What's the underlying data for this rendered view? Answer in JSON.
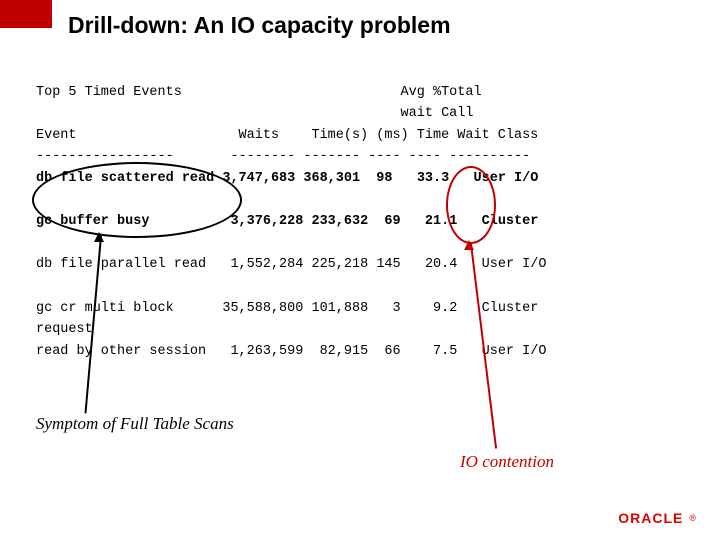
{
  "title": "Drill-down: An IO capacity problem",
  "report": {
    "heading_line1": "Top 5 Timed Events                           Avg %Total",
    "heading_line2": "                                             wait Call",
    "columns_line": "Event                    Waits    Time(s) (ms) Time Wait Class",
    "sep_line": "-----------------       -------- ------- ---- ---- ----------",
    "rows": [
      {
        "event": "db file scattered read",
        "waits": "3,747,683",
        "time_s": "368,301",
        "avg_ms": "98",
        "pct": "33.3",
        "class": "User I/O",
        "bold": true
      },
      {
        "event": "gc buffer busy",
        "waits": "3,376,228",
        "time_s": "233,632",
        "avg_ms": "69",
        "pct": "21.1",
        "class": "Cluster",
        "bold": true
      },
      {
        "event": "db file parallel read",
        "waits": "1,552,284",
        "time_s": "225,218",
        "avg_ms": "145",
        "pct": "20.4",
        "class": "User I/O",
        "bold": false
      },
      {
        "event": "gc cr multi block\nrequest",
        "waits": "35,588,800",
        "time_s": "101,888",
        "avg_ms": "3",
        "pct": "9.2",
        "class": "Cluster",
        "bold": false
      },
      {
        "event": "read by other session",
        "waits": "1,263,599",
        "time_s": "82,915",
        "avg_ms": "66",
        "pct": "7.5",
        "class": "User I/O",
        "bold": false
      }
    ]
  },
  "annotations": {
    "symptom": "Symptom of Full Table Scans",
    "io_contention": "IO contention"
  },
  "logo": {
    "text": "ORACLE",
    "reg": "®"
  }
}
